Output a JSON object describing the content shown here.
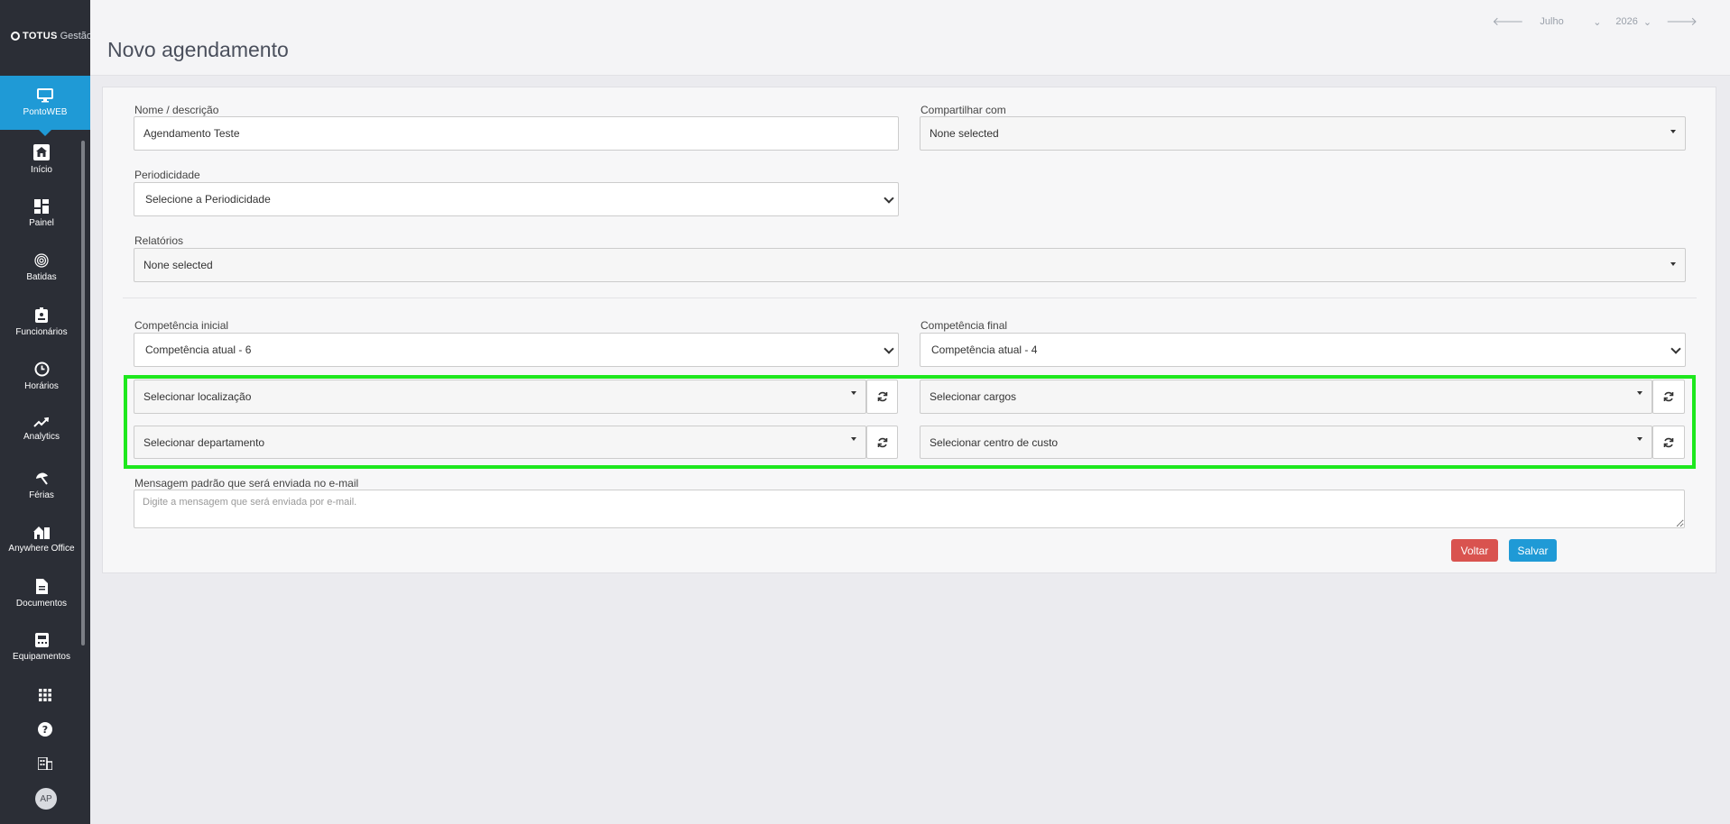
{
  "brand": {
    "name": "TOTUS",
    "suffix": "Gestão"
  },
  "sidebar": {
    "active_item": {
      "label": "PontoWEB",
      "icon": "monitor-icon"
    },
    "items": [
      {
        "label": "Início",
        "icon": "home-icon"
      },
      {
        "label": "Painel",
        "icon": "dashboard-icon"
      },
      {
        "label": "Batidas",
        "icon": "fingerprint-icon"
      },
      {
        "label": "Funcionários",
        "icon": "badge-icon"
      },
      {
        "label": "Horários",
        "icon": "clock-icon"
      },
      {
        "label": "Analytics",
        "icon": "trend-icon"
      },
      {
        "label": "Férias",
        "icon": "umbrella-icon"
      },
      {
        "label": "Anywhere Office",
        "icon": "house-building-icon"
      },
      {
        "label": "Documentos",
        "icon": "document-icon"
      },
      {
        "label": "Equipamentos",
        "icon": "device-icon"
      }
    ],
    "bottom_icons": [
      "apps-grid-icon",
      "help-icon",
      "building-icon"
    ],
    "avatar_initials": "AP"
  },
  "header": {
    "title": "Novo agendamento",
    "month": "Julho",
    "year": "2026"
  },
  "form": {
    "nome_label": "Nome / descrição",
    "nome_value": "Agendamento Teste",
    "compartilhar_label": "Compartilhar com",
    "compartilhar_value": "None selected",
    "periodicidade_label": "Periodicidade",
    "periodicidade_value": "Selecione a Periodicidade",
    "relatorios_label": "Relatórios",
    "relatorios_value": "None selected",
    "competencia_inicial_label": "Competência inicial",
    "competencia_inicial_value": "Competência atual - 6",
    "competencia_final_label": "Competência final",
    "competencia_final_value": "Competência atual - 4",
    "localizacao_placeholder": "Selecionar localização",
    "cargos_placeholder": "Selecionar cargos",
    "departamento_placeholder": "Selecionar departamento",
    "centro_custo_placeholder": "Selecionar centro de custo",
    "mensagem_label": "Mensagem padrão que será enviada no e-mail",
    "mensagem_placeholder": "Digite a mensagem que será enviada por e-mail.",
    "voltar_label": "Voltar",
    "salvar_label": "Salvar"
  },
  "colors": {
    "accent": "#1f9ad6",
    "danger": "#d9534f",
    "sidebar_bg": "#2b2e36",
    "highlight": "#1ee81e"
  }
}
